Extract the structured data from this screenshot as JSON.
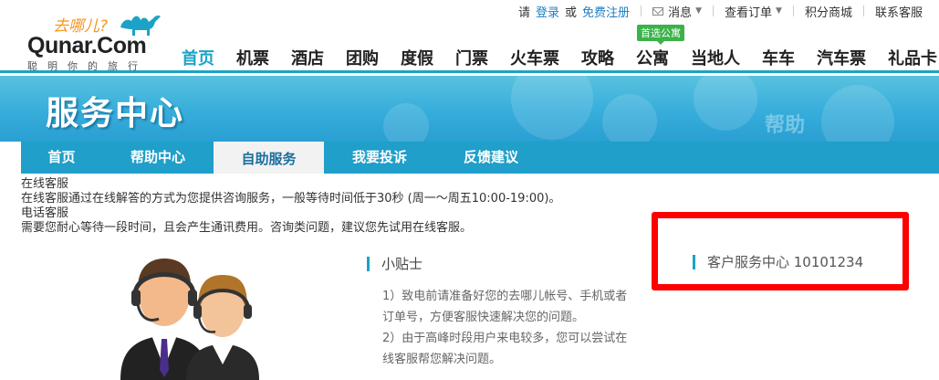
{
  "logo": {
    "slogan": "去哪儿?",
    "brand": "Qunar.Com",
    "tagline": "聪明你的旅行"
  },
  "toplinks": {
    "please": "请",
    "login": "登录",
    "or": "或",
    "register": "免费注册",
    "messages": "消息",
    "orders": "查看订单",
    "points_mall": "积分商城",
    "contact": "联系客服"
  },
  "mainnav": {
    "badge": "首选公寓",
    "items": [
      "首页",
      "机票",
      "酒店",
      "团购",
      "度假",
      "门票",
      "火车票",
      "攻略",
      "公寓",
      "当地人",
      "车车",
      "汽车票",
      "礼品卡"
    ]
  },
  "banner": {
    "title": "服务中心",
    "decor_text": "帮助"
  },
  "subnav": {
    "tabs": [
      "首页",
      "帮助中心",
      "自助服务",
      "我要投诉",
      "反馈建议"
    ],
    "active_index": 2
  },
  "content": {
    "online_title": "在线客服",
    "online_desc": "在线客服通过在线解答的方式为您提供咨询服务，一般等待时间低于30秒 (周一～周五10:00-19:00)。",
    "phone_title": "电话客服",
    "phone_desc": "需要您耐心等待一段时间，且会产生通讯费用。咨询类问题，建议您先试用在线客服。"
  },
  "tips": {
    "title": "小贴士",
    "line1": "1）致电前请准备好您的去哪儿帐号、手机或者",
    "line2": "订单号，方便客服快速解决您的问题。",
    "line3": "2）由于高峰时段用户来电较多，您可以尝试在",
    "line4": "线客服帮您解决问题。"
  },
  "hotline": {
    "text": "客户服务中心 10101234"
  },
  "colors": {
    "accent": "#1aa3c6",
    "link": "#1b7fc4",
    "highlight_box": "#ff0000",
    "badge": "#3bb24a",
    "logo_orange": "#f7941d"
  }
}
